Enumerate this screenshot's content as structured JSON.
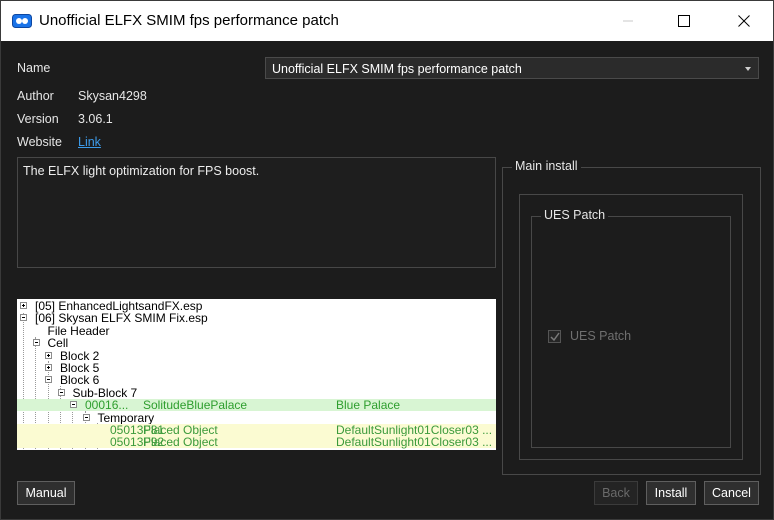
{
  "window": {
    "title": "Unofficial ELFX SMIM fps performance patch",
    "controls": [
      "minimize-icon",
      "maximize-icon",
      "close-icon"
    ]
  },
  "info": {
    "name_label": "Name",
    "name_value": "Unofficial ELFX SMIM fps performance patch",
    "author_label": "Author",
    "author_value": "Skysan4298",
    "version_label": "Version",
    "version_value": "3.06.1",
    "website_label": "Website",
    "website_link": "Link"
  },
  "description": "The ELFX light optimization for FPS boost.",
  "tree": {
    "rows": [
      {
        "text": "[05] EnhancedLightsandFX.esp",
        "indent": 0,
        "expander": "plus",
        "color": "#000000",
        "bg": ""
      },
      {
        "text": "[06] Skysan ELFX SMIM Fix.esp",
        "indent": 0,
        "expander": "minus",
        "color": "#000000",
        "bg": ""
      },
      {
        "text": "File Header",
        "indent": 1,
        "expander": "",
        "color": "#000000",
        "bg": ""
      },
      {
        "text": "Cell",
        "indent": 1,
        "expander": "minus",
        "color": "#000000",
        "bg": ""
      },
      {
        "text": "Block 2",
        "indent": 2,
        "expander": "plus",
        "color": "#000000",
        "bg": ""
      },
      {
        "text": "Block 5",
        "indent": 2,
        "expander": "plus",
        "color": "#000000",
        "bg": ""
      },
      {
        "text": "Block 6",
        "indent": 2,
        "expander": "minus",
        "color": "#000000",
        "bg": ""
      },
      {
        "text": "Sub-Block 7",
        "indent": 3,
        "expander": "minus",
        "color": "#000000",
        "bg": ""
      },
      {
        "text": "00016...",
        "col2": "SolitudeBluePalace",
        "col3": "Blue Palace",
        "indent": 4,
        "expander": "minus",
        "color": "#2e9e2e",
        "bg": "#d8f5d3"
      },
      {
        "text": "Temporary",
        "indent": 5,
        "expander": "minus",
        "color": "#000000",
        "bg": ""
      },
      {
        "text": "05013F81",
        "col2": "Placed Object",
        "col3": "DefaultSunlight01Closer03 ...",
        "indent": 6,
        "expander": "",
        "color": "#3b9a3b",
        "bg": "#fbfbd2"
      },
      {
        "text": "05013F92",
        "col2": "Placed Object",
        "col3": "DefaultSunlight01Closer03 ...",
        "indent": 6,
        "expander": "",
        "color": "#3b9a3b",
        "bg": "#fbfbd2"
      }
    ]
  },
  "main_install": {
    "title": "Main install",
    "group_title": "UES Patch",
    "option_label": "UES Patch",
    "option_checked": true
  },
  "buttons": {
    "manual": "Manual",
    "back": "Back",
    "install": "Install",
    "cancel": "Cancel"
  }
}
